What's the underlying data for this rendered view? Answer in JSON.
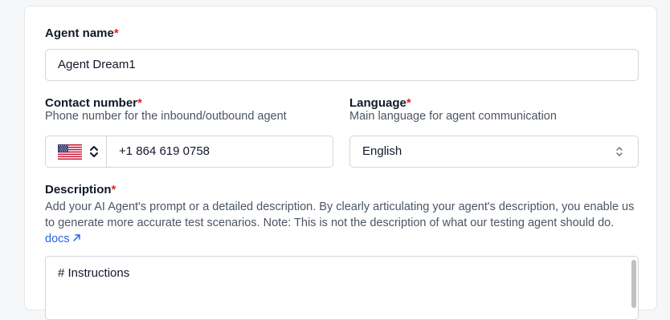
{
  "agent_name": {
    "label": "Agent name",
    "required_mark": "*",
    "value": "Agent Dream1"
  },
  "contact_number": {
    "label": "Contact number",
    "required_mark": "*",
    "help": "Phone number for the inbound/outbound agent",
    "country_flag": "us-flag-icon",
    "value": "+1 864 619 0758"
  },
  "language": {
    "label": "Language",
    "required_mark": "*",
    "help": "Main language for agent communication",
    "selected": "English"
  },
  "description": {
    "label": "Description",
    "required_mark": "*",
    "help": "Add your AI Agent's prompt or a detailed description. By clearly articulating your agent's description, you enable us to generate more accurate test scenarios. Note: This is not the description of what our testing agent should do.",
    "docs_link": "docs",
    "value": "# Instructions"
  },
  "colors": {
    "required": "#dc2626",
    "link": "#2563eb",
    "border": "#d1d5db"
  }
}
